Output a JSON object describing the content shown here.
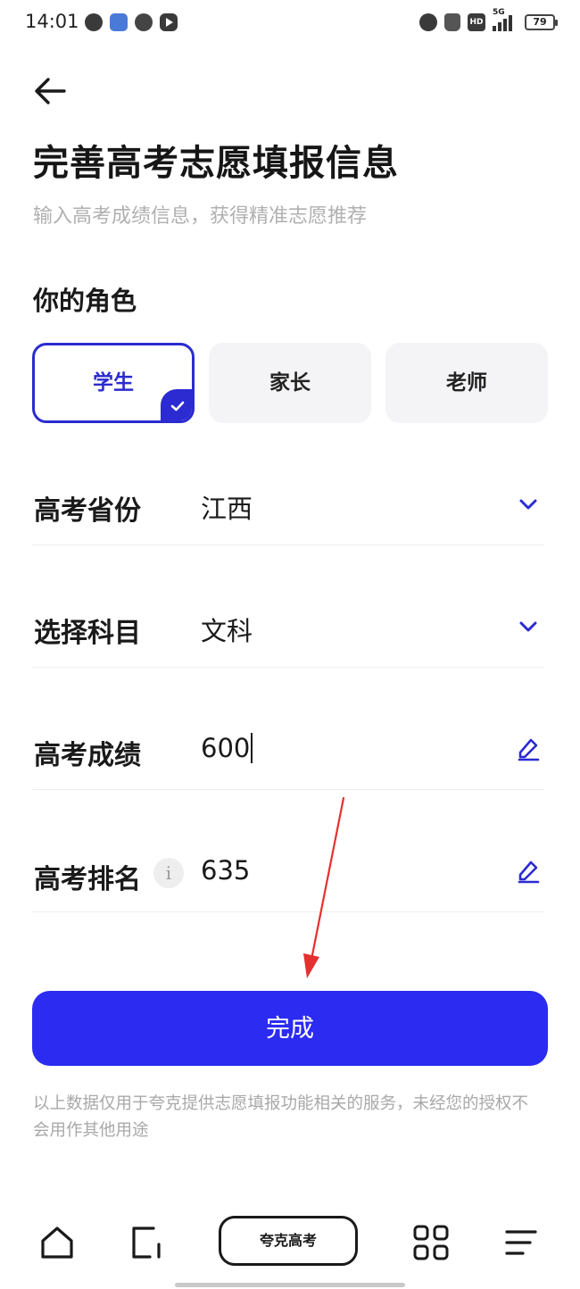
{
  "status_bar": {
    "time": "14:01",
    "network": "5G",
    "hd_badge": "HD",
    "battery": "79",
    "left_icons": [
      "chat-icon",
      "app-icon",
      "flower-icon",
      "play-icon"
    ],
    "right_icons": [
      "alarm-icon",
      "mute-bell-icon",
      "hd-icon",
      "signal-icon",
      "battery-icon"
    ]
  },
  "header": {
    "back_icon": "arrow-left-icon",
    "title": "完善高考志愿填报信息",
    "subtitle": "输入高考成绩信息，获得精准志愿推荐"
  },
  "roles": {
    "label": "你的角色",
    "options": [
      {
        "label": "学生",
        "selected": true
      },
      {
        "label": "家长",
        "selected": false
      },
      {
        "label": "老师",
        "selected": false
      }
    ],
    "accent_color": "#2B2BD1"
  },
  "form": {
    "province": {
      "label": "高考省份",
      "value": "江西",
      "icon": "chevron-down-icon"
    },
    "subject": {
      "label": "选择科目",
      "value": "文科",
      "icon": "chevron-down-icon"
    },
    "score": {
      "label": "高考成绩",
      "value": "600",
      "icon": "edit-icon"
    },
    "rank": {
      "label": "高考排名",
      "info": "i",
      "value": "635",
      "icon": "edit-icon"
    }
  },
  "submit": {
    "label": "完成",
    "color": "#2B2BF2"
  },
  "disclaimer": "以上数据仅用于夸克提供志愿填报功能相关的服务，未经您的授权不会用作其他用途",
  "bottom_nav": {
    "items": [
      "home-icon",
      "tabs-icon",
      "grid-icon",
      "menu-icon"
    ],
    "center_label": "夸克高考"
  },
  "annotation": {
    "arrow_color": "#E53030"
  }
}
